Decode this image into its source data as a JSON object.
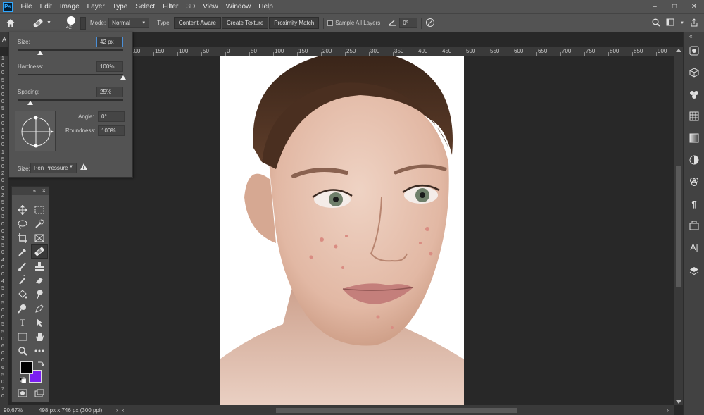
{
  "menubar": {
    "logo": "Ps",
    "items": [
      "File",
      "Edit",
      "Image",
      "Layer",
      "Type",
      "Select",
      "Filter",
      "3D",
      "View",
      "Window",
      "Help"
    ],
    "window_controls": [
      "–",
      "□",
      "✕"
    ]
  },
  "options": {
    "brush_size": "42",
    "mode_label": "Mode:",
    "mode_value": "Normal",
    "type_label": "Type:",
    "type_buttons": [
      "Content-Aware",
      "Create Texture",
      "Proximity Match"
    ],
    "sample_all_layers": "Sample All Layers",
    "angle_value": "0°"
  },
  "brush_panel": {
    "size_label": "Size:",
    "size_value": "42 px",
    "hardness_label": "Hardness:",
    "hardness_value": "100%",
    "spacing_label": "Spacing:",
    "spacing_value": "25%",
    "angle_label": "Angle:",
    "angle_value": "0°",
    "roundness_label": "Roundness:",
    "roundness_value": "100%",
    "pressure_label": "Size:",
    "pressure_value": "Pen Pressure",
    "size_fraction": 0.21,
    "hardness_fraction": 1.0,
    "spacing_fraction": 0.12
  },
  "ruler_top": [
    "100",
    "150",
    "100",
    "50",
    "0",
    "50",
    "100",
    "150",
    "200",
    "250",
    "300",
    "350",
    "400",
    "450",
    "500",
    "550",
    "600",
    "650",
    "700",
    "750",
    "800",
    "850",
    "900"
  ],
  "ruler_left": [
    "1",
    "0",
    "0",
    "5",
    "0",
    "0",
    "0",
    "5",
    "0",
    "0",
    "1",
    "0",
    "0",
    "1",
    "5",
    "0",
    "2",
    "0",
    "0",
    "2",
    "5",
    "0",
    "3",
    "0",
    "0",
    "3",
    "5",
    "0",
    "4",
    "0",
    "0",
    "4",
    "5",
    "0",
    "5",
    "0",
    "0",
    "5",
    "5",
    "0",
    "6",
    "0",
    "0",
    "6",
    "5",
    "0",
    "7",
    "0"
  ],
  "toolbox": {
    "header": [
      "«",
      "×"
    ],
    "foreground_color": "#000000",
    "background_color": "#7b1ff2"
  },
  "status": {
    "zoom": "90,67%",
    "doc_info": "498 px x 746 px (300 ppi)"
  }
}
